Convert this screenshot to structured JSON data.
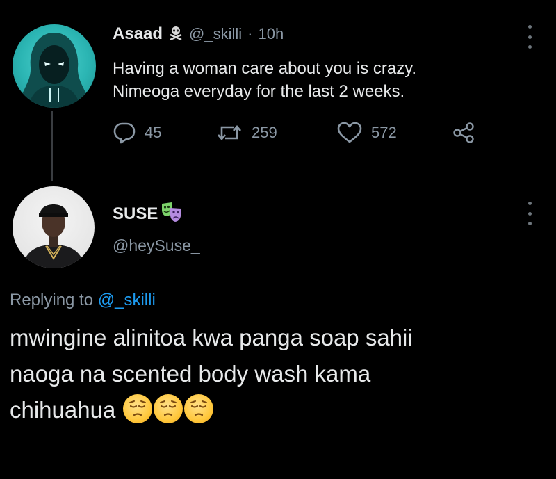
{
  "tweet1": {
    "display_name": "Asaad",
    "name_icon": "skull-crossbones-icon",
    "handle": "@_skilli",
    "separator": "·",
    "time": "10h",
    "text_line1": "Having a woman care about you is crazy.",
    "text_line2": "Nimeoga everyday for the last 2 weeks.",
    "replies": "45",
    "retweets": "259",
    "likes": "572"
  },
  "tweet2": {
    "display_name": "SUSE",
    "name_icon": "performing-arts-icon",
    "handle": "@heySuse_",
    "replying_prefix": "Replying to",
    "replying_handle": "@_skilli",
    "text_line1": "mwingine alinitoa kwa panga soap sahii",
    "text_line2": "naoga na scented body wash kama",
    "text_line3": "chihuahua",
    "emoji": "pensive-face-icon"
  },
  "colors": {
    "background": "#000000",
    "text": "#e7e9ea",
    "muted": "#8b98a5",
    "link": "#1d9bf0",
    "avatar1_bg": "#2bb5b3"
  }
}
